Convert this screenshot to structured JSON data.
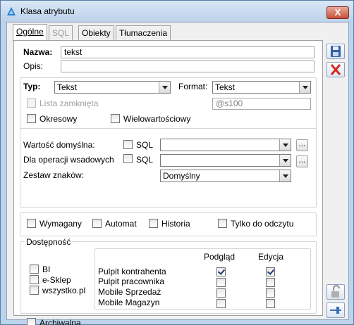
{
  "window": {
    "title": "Klasa atrybutu",
    "close_label": "X"
  },
  "tabs": [
    {
      "label": "Ogólne"
    },
    {
      "label": "SQL"
    },
    {
      "label": "Obiekty"
    },
    {
      "label": "Tłumaczenia"
    }
  ],
  "nazwa": {
    "label": "Nazwa:",
    "value": "tekst"
  },
  "opis": {
    "label": "Opis:",
    "value": ""
  },
  "typ": {
    "label": "Typ:",
    "value": "Tekst"
  },
  "format": {
    "label": "Format:",
    "value": "Tekst",
    "mask": "@s100"
  },
  "options": {
    "lista_zamknieta": "Lista zamknięta",
    "okresowy": "Okresowy",
    "wielowartosciowy": "Wielowartościowy"
  },
  "wartosc_domyslna": {
    "label": "Wartość domyślna:",
    "sql_label": "SQL",
    "value": "",
    "dots": "..."
  },
  "dla_operacji": {
    "label": "Dla operacji wsadowych",
    "sql_label": "SQL",
    "value": "",
    "dots": "..."
  },
  "zestaw_znakow": {
    "label": "Zestaw znaków:",
    "value": "Domyślny"
  },
  "flags": {
    "wymagany": "Wymagany",
    "automat": "Automat",
    "historia": "Historia",
    "tylko_do_odczytu": "Tylko do odczytu"
  },
  "dostepnosc": {
    "title": "Dostępność",
    "left_items": [
      "BI",
      "e-Sklep",
      "wszystko.pl"
    ],
    "col_podglad": "Podgląd",
    "col_edycja": "Edycja",
    "rows": [
      {
        "label": "Pulpit kontrahenta",
        "podglad": true,
        "edycja": true
      },
      {
        "label": "Pulpit pracownika",
        "podglad": false,
        "edycja": false
      },
      {
        "label": "Mobile Sprzedaż",
        "podglad": false,
        "edycja": false
      },
      {
        "label": "Mobile Magazyn",
        "podglad": false,
        "edycja": false
      }
    ]
  },
  "archiwalna": "Archiwalna",
  "icons": {
    "save": "save-icon",
    "delete": "delete-icon",
    "lock": "lock-icon",
    "pin": "pin-icon"
  }
}
